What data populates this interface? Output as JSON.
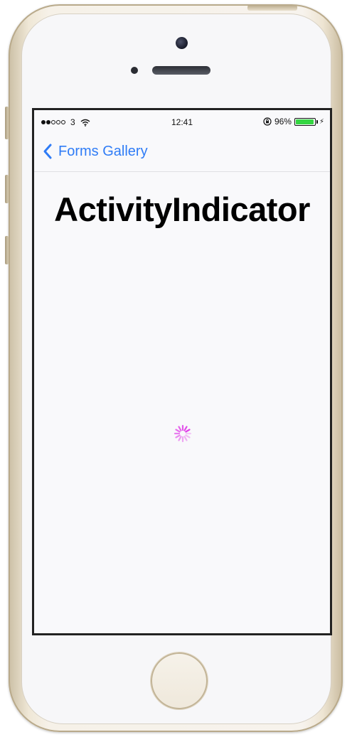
{
  "device": {
    "frame_color": "#efe7d6",
    "accent_color": "#2f7cf6",
    "screen_background": "#f9f9fb"
  },
  "status_bar": {
    "signal_bars_filled": 2,
    "signal_bars_total": 5,
    "carrier": "3",
    "wifi_icon": "wifi-icon",
    "time": "12:41",
    "lock_icon": "rotation-lock-icon",
    "battery_percent_label": "96%",
    "battery_level": 0.96,
    "battery_color": "#35d642",
    "charging_icon": "bolt-icon"
  },
  "nav_bar": {
    "back_label": "Forms Gallery",
    "back_icon": "chevron-left-icon"
  },
  "page": {
    "title": "ActivityIndicator"
  },
  "activity_indicator": {
    "color": "#e040e8",
    "running": true
  }
}
